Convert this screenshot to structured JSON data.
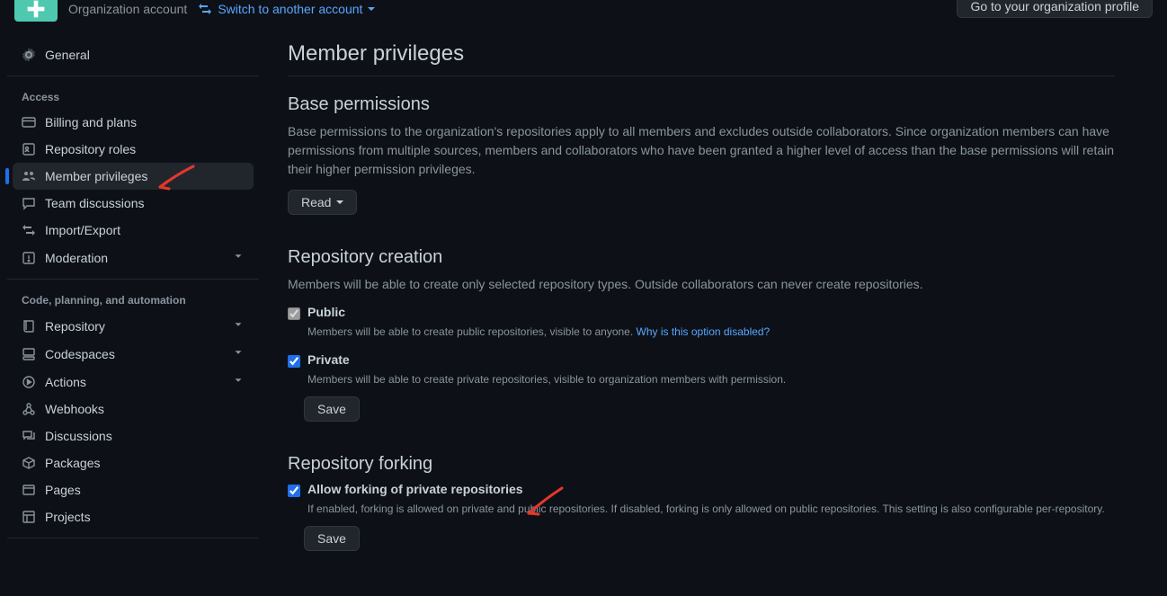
{
  "header": {
    "account_type": "Organization account",
    "switch_label": "Switch to another account",
    "profile_button": "Go to your organization profile"
  },
  "sidebar": {
    "general": "General",
    "section_access": "Access",
    "billing": "Billing and plans",
    "repo_roles": "Repository roles",
    "member_priv": "Member privileges",
    "team_disc": "Team discussions",
    "import_export": "Import/Export",
    "moderation": "Moderation",
    "section_code": "Code, planning, and automation",
    "repository": "Repository",
    "codespaces": "Codespaces",
    "actions": "Actions",
    "webhooks": "Webhooks",
    "discussions": "Discussions",
    "packages": "Packages",
    "pages": "Pages",
    "projects": "Projects"
  },
  "main": {
    "title": "Member privileges",
    "base": {
      "heading": "Base permissions",
      "desc": "Base permissions to the organization's repositories apply to all members and excludes outside collaborators. Since organization members can have permissions from multiple sources, members and collaborators who have been granted a higher level of access than the base permissions will retain their higher permission privileges.",
      "button": "Read"
    },
    "repo_creation": {
      "heading": "Repository creation",
      "desc": "Members will be able to create only selected repository types. Outside collaborators can never create repositories.",
      "public_label": "Public",
      "public_desc": "Members will be able to create public repositories, visible to anyone. ",
      "public_link": "Why is this option disabled?",
      "private_label": "Private",
      "private_desc": "Members will be able to create private repositories, visible to organization members with permission.",
      "save": "Save"
    },
    "forking": {
      "heading": "Repository forking",
      "allow_label": "Allow forking of private repositories",
      "allow_desc": "If enabled, forking is allowed on private and public repositories. If disabled, forking is only allowed on public repositories. This setting is also configurable per-repository.",
      "save": "Save"
    }
  }
}
